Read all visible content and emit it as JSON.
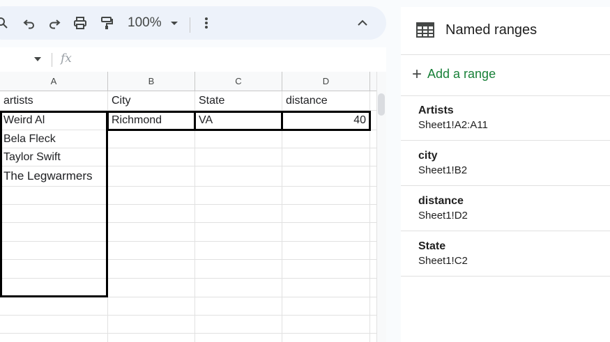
{
  "toolbar": {
    "zoom": "100%"
  },
  "formula_bar": {
    "fx": "fx"
  },
  "grid": {
    "columns": [
      "A",
      "B",
      "C",
      "D"
    ],
    "row1": [
      "artists",
      "City",
      "State",
      "distance"
    ],
    "row2": [
      "Weird Al",
      "Richmond",
      "VA",
      "40"
    ],
    "artists": [
      "Bela Fleck",
      "Taylor Swift",
      "The Legwarmers"
    ]
  },
  "panel": {
    "title": "Named ranges",
    "add_label": "Add a range",
    "ranges": [
      {
        "name": "Artists",
        "ref": "Sheet1!A2:A11"
      },
      {
        "name": "city",
        "ref": "Sheet1!B2"
      },
      {
        "name": "distance",
        "ref": "Sheet1!D2"
      },
      {
        "name": "State",
        "ref": "Sheet1!C2"
      }
    ]
  }
}
